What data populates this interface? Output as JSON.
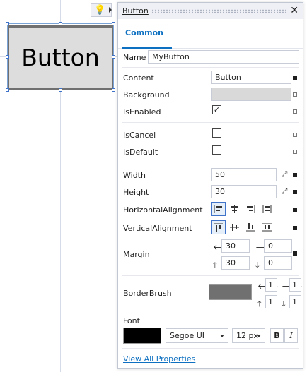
{
  "designer": {
    "button_text": "Button"
  },
  "panel": {
    "title": "Button",
    "close_glyph": "✕",
    "tab": "Common",
    "name_label": "Name",
    "name_value": "MyButton",
    "content_label": "Content",
    "content_value": "Button",
    "background_label": "Background",
    "background_color": "#d9d9d9",
    "isenabled_label": "IsEnabled",
    "isenabled_checked": true,
    "iscancel_label": "IsCancel",
    "isdefault_label": "IsDefault",
    "width_label": "Width",
    "width_value": "50",
    "height_label": "Height",
    "height_value": "30",
    "halign_label": "HorizontalAlignment",
    "valign_label": "VerticalAlignment",
    "margin_label": "Margin",
    "margin": {
      "left": "30",
      "right": "0",
      "top": "30",
      "bottom": "0"
    },
    "borderbrush_label": "BorderBrush",
    "borderbrush_color": "#707070",
    "border": {
      "left": "1",
      "right": "1",
      "top": "1",
      "bottom": "1"
    },
    "font_label": "Font",
    "font_color": "#000000",
    "font_family": "Segoe UI",
    "font_size": "12 px",
    "bold": "B",
    "italic": "I",
    "view_all": "View All Properties"
  },
  "icons": {
    "lightbulb": "lightbulb-icon",
    "check": "✓",
    "expand": "expand-icon"
  }
}
